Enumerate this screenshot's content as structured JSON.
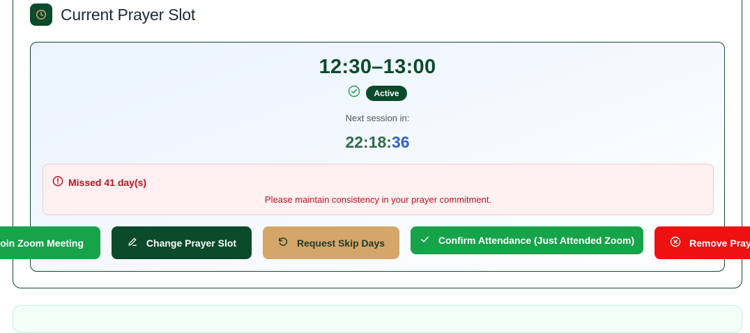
{
  "header": {
    "title": "Current Prayer Slot",
    "icon": "clock-icon"
  },
  "slot": {
    "time_range": "12:30–13:00",
    "status": "Active",
    "next_label": "Next session in:",
    "countdown_hm": "22:18:",
    "countdown_s": "36"
  },
  "missed": {
    "title": "Missed 41 day(s)",
    "message": "Please maintain consistency in your prayer commitment."
  },
  "actions": {
    "zoom": "Join Zoom Meeting",
    "change": "Change Prayer Slot",
    "skip": "Request Skip Days",
    "confirm": "Confirm Attendance (Just Attended Zoom)",
    "remove": "Remove Prayer Slot"
  },
  "colors": {
    "primary": "#0b4a2a",
    "success": "#16a34a",
    "danger": "#ee1111",
    "warning": "#d5a66a",
    "accent": "#2e63c9"
  }
}
